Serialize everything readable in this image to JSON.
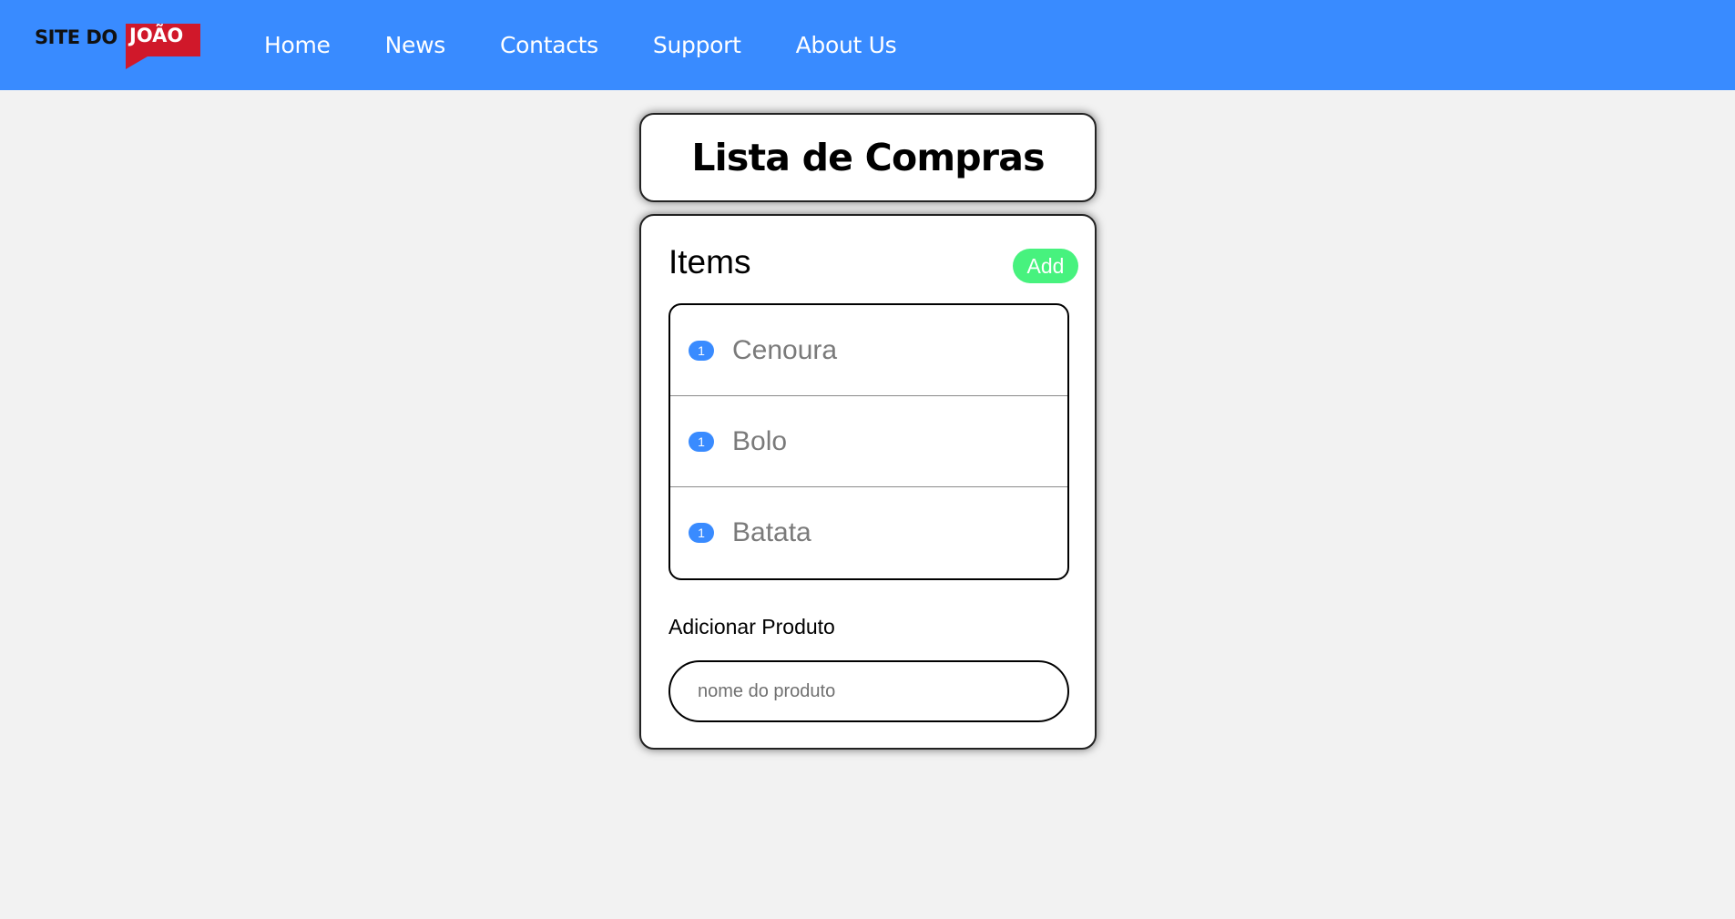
{
  "brand": {
    "logo_black": "SITE DO",
    "logo_white": "JOÃO"
  },
  "nav": {
    "items": [
      "Home",
      "News",
      "Contacts",
      "Support",
      "About Us"
    ]
  },
  "page": {
    "title": "Lista de Compras"
  },
  "list": {
    "heading": "Items",
    "add_label": "Add",
    "items": [
      {
        "count": "1",
        "name": "Cenoura"
      },
      {
        "count": "1",
        "name": "Bolo"
      },
      {
        "count": "1",
        "name": "Batata"
      }
    ]
  },
  "form": {
    "label": "Adicionar Produto",
    "placeholder": "nome do produto",
    "value": ""
  },
  "colors": {
    "navbar": "#398bff",
    "add_button": "#47f27e",
    "badge": "#398bff",
    "logo_red": "#d0182a"
  }
}
